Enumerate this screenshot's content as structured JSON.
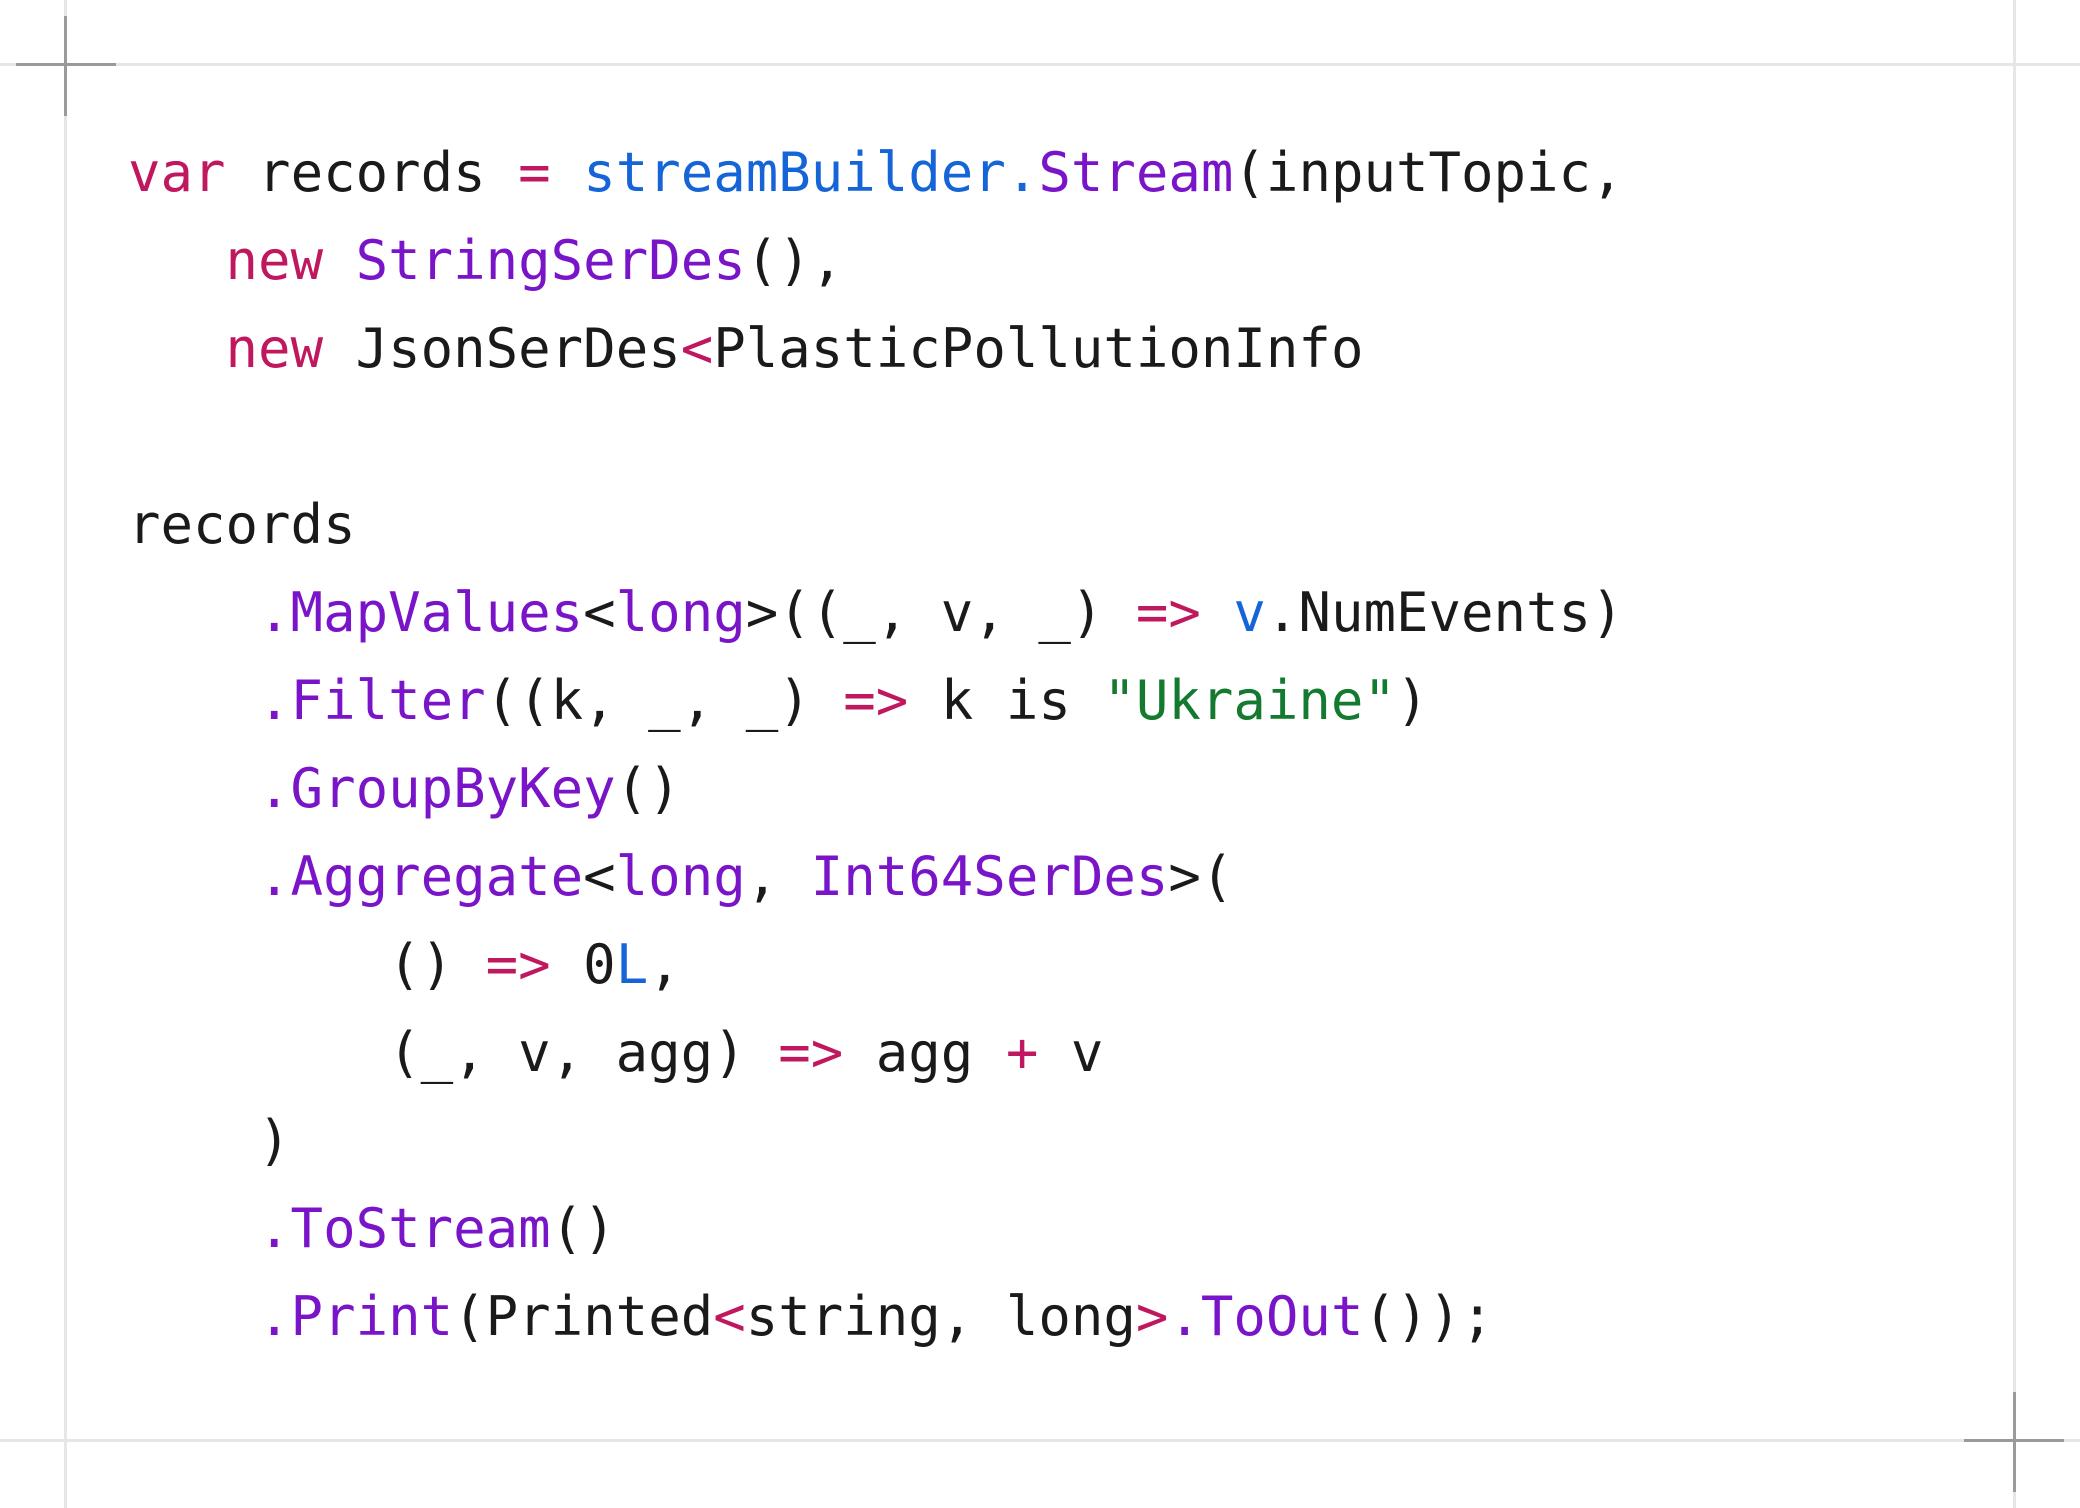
{
  "colors": {
    "text": "#1a1a1a",
    "keyword": "#c0185e",
    "method": "#7a14c9",
    "variable": "#1565d8",
    "string": "#137a30"
  },
  "code": {
    "lines": [
      [
        {
          "t": "var",
          "c": "keyword"
        },
        {
          "t": " records ",
          "c": "text"
        },
        {
          "t": "=",
          "c": "keyword"
        },
        {
          "t": " ",
          "c": "text"
        },
        {
          "t": "streamBuilder.",
          "c": "variable"
        },
        {
          "t": "Stream",
          "c": "method"
        },
        {
          "t": "(inputTopic,",
          "c": "text"
        }
      ],
      [
        {
          "t": "   ",
          "c": "text"
        },
        {
          "t": "new",
          "c": "keyword"
        },
        {
          "t": " ",
          "c": "text"
        },
        {
          "t": "StringSerDes",
          "c": "method"
        },
        {
          "t": "(),",
          "c": "text"
        }
      ],
      [
        {
          "t": "   ",
          "c": "text"
        },
        {
          "t": "new",
          "c": "keyword"
        },
        {
          "t": " JsonSerDes",
          "c": "text"
        },
        {
          "t": "<",
          "c": "keyword"
        },
        {
          "t": "PlasticPollutionInfo",
          "c": "text"
        }
      ],
      [],
      [
        {
          "t": "records",
          "c": "text"
        }
      ],
      [
        {
          "t": "    ",
          "c": "text"
        },
        {
          "t": ".MapValues",
          "c": "method"
        },
        {
          "t": "<",
          "c": "text"
        },
        {
          "t": "long",
          "c": "method"
        },
        {
          "t": ">((_, v, _) ",
          "c": "text"
        },
        {
          "t": "=>",
          "c": "keyword"
        },
        {
          "t": " ",
          "c": "text"
        },
        {
          "t": "v",
          "c": "variable"
        },
        {
          "t": ".NumEvents)",
          "c": "text"
        }
      ],
      [
        {
          "t": "    ",
          "c": "text"
        },
        {
          "t": ".Filter",
          "c": "method"
        },
        {
          "t": "((k, _, _) ",
          "c": "text"
        },
        {
          "t": "=>",
          "c": "keyword"
        },
        {
          "t": " k is ",
          "c": "text"
        },
        {
          "t": "\"Ukraine\"",
          "c": "string"
        },
        {
          "t": ")",
          "c": "text"
        }
      ],
      [
        {
          "t": "    ",
          "c": "text"
        },
        {
          "t": ".GroupByKey",
          "c": "method"
        },
        {
          "t": "()",
          "c": "text"
        }
      ],
      [
        {
          "t": "    ",
          "c": "text"
        },
        {
          "t": ".Aggregate",
          "c": "method"
        },
        {
          "t": "<",
          "c": "text"
        },
        {
          "t": "long",
          "c": "method"
        },
        {
          "t": ", ",
          "c": "text"
        },
        {
          "t": "Int64SerDes",
          "c": "method"
        },
        {
          "t": ">(",
          "c": "text"
        }
      ],
      [
        {
          "t": "        () ",
          "c": "text"
        },
        {
          "t": "=>",
          "c": "keyword"
        },
        {
          "t": " 0",
          "c": "text"
        },
        {
          "t": "L",
          "c": "variable"
        },
        {
          "t": ",",
          "c": "text"
        }
      ],
      [
        {
          "t": "        (_, v, agg) ",
          "c": "text"
        },
        {
          "t": "=>",
          "c": "keyword"
        },
        {
          "t": " agg ",
          "c": "text"
        },
        {
          "t": "+",
          "c": "keyword"
        },
        {
          "t": " v",
          "c": "text"
        }
      ],
      [
        {
          "t": "    )",
          "c": "text"
        }
      ],
      [
        {
          "t": "    ",
          "c": "text"
        },
        {
          "t": ".ToStream",
          "c": "method"
        },
        {
          "t": "()",
          "c": "text"
        }
      ],
      [
        {
          "t": "    ",
          "c": "text"
        },
        {
          "t": ".Print",
          "c": "method"
        },
        {
          "t": "(Printed",
          "c": "text"
        },
        {
          "t": "<",
          "c": "keyword"
        },
        {
          "t": "string, long",
          "c": "text"
        },
        {
          "t": ">",
          "c": "keyword"
        },
        {
          "t": ".ToOut",
          "c": "method"
        },
        {
          "t": "());",
          "c": "text"
        }
      ]
    ]
  }
}
